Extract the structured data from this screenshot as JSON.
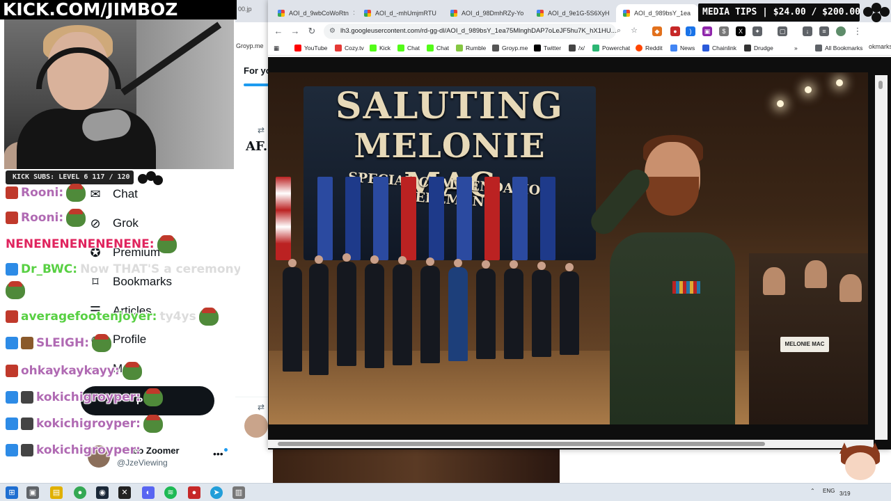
{
  "stream": {
    "banner": "KICK.COM/JIMBOZ",
    "subs_label": "KICK SUBS: LEVEL 6 117 / 120"
  },
  "media_tips": "MEDIA TIPS | $24.00 / $200.00",
  "x_nav": {
    "items": [
      {
        "label": "Chat",
        "icon": "chat-icon",
        "glyph": "✉"
      },
      {
        "label": "Grok",
        "icon": "grok-icon",
        "glyph": "⊘"
      },
      {
        "label": "Premium",
        "icon": "premium-icon",
        "glyph": "✪"
      },
      {
        "label": "Bookmarks",
        "icon": "bookmark-icon",
        "glyph": "⌑"
      },
      {
        "label": "Articles",
        "icon": "articles-icon",
        "glyph": "☰"
      },
      {
        "label": "Profile",
        "icon": "profile-icon",
        "glyph": "☺"
      },
      {
        "label": "M",
        "icon": "more-icon",
        "glyph": "⋯"
      }
    ],
    "post_label": "P",
    "account": {
      "name": "Jimbo Zoomer",
      "handle": "@JzeViewing",
      "more": "•••"
    }
  },
  "chat": {
    "messages": [
      {
        "user": "Rooni:",
        "text": "",
        "color": "#b06ab3"
      },
      {
        "user": "Rooni:",
        "text": "",
        "color": "#b06ab3"
      },
      {
        "user": "NENENENENENENENE:",
        "text": "",
        "color": "#e0245e"
      },
      {
        "user": "Dr_BWC:",
        "text": "Now THAT'S a ceremony",
        "color": "#58d043"
      },
      {
        "user": "averagefootenjoyer:",
        "text": "ty4ys",
        "color": "#58d043"
      },
      {
        "user": "SLEIGH:",
        "text": "",
        "color": "#b06ab3"
      },
      {
        "user": "ohkaykaykayy:",
        "text": "",
        "color": "#b06ab3"
      },
      {
        "user": "kokichigroyper:",
        "text": "",
        "color": "#b06ab3"
      },
      {
        "user": "kokichigroyper:",
        "text": "",
        "color": "#b06ab3"
      },
      {
        "user": "kokichigroyper:",
        "text": "",
        "color": "#b06ab3"
      }
    ]
  },
  "background_page": {
    "for_you": "For yo",
    "af_text": "AF.",
    "groyp": "Groyp.me",
    "tab_fragment": "00.jp",
    "bookmarks_fragment": "okmarks"
  },
  "browser": {
    "tabs": [
      {
        "title": "AOI_d_9wbCoWoRtn"
      },
      {
        "title": "AOI_d_-mhUmjmRTU"
      },
      {
        "title": "AOI_d_98DmhRZy-Yo"
      },
      {
        "title": "AOI_d_9e1G-5S6XyH"
      },
      {
        "title": "AOI_d_989bsY_1ea"
      }
    ],
    "url": "lh3.googleusercontent.com/rd-gg-dl/AOI_d_989bsY_1ea75MlnghDAP7oLeJF5hu7K_hX1HU...",
    "bookmarks": [
      {
        "label": "YouTube",
        "color": "#ff0000"
      },
      {
        "label": "Cozy.tv",
        "color": "#e53935"
      },
      {
        "label": "Kick",
        "color": "#53fc18"
      },
      {
        "label": "Chat",
        "color": "#53fc18"
      },
      {
        "label": "Chat",
        "color": "#53fc18"
      },
      {
        "label": "Rumble",
        "color": "#85c742"
      },
      {
        "label": "Groyp.me",
        "color": "#555555"
      },
      {
        "label": "Twitter",
        "color": "#000000"
      },
      {
        "label": "/x/",
        "color": "#444444"
      },
      {
        "label": "Powerchat",
        "color": "#2bb673"
      },
      {
        "label": "Reddit",
        "color": "#ff4500"
      },
      {
        "label": "News",
        "color": "#4285f4"
      },
      {
        "label": "Chainlink",
        "color": "#2a5ada"
      },
      {
        "label": "Drudge",
        "color": "#333333"
      }
    ],
    "all_bookmarks": "All Bookmarks",
    "more_chevron": "»"
  },
  "image": {
    "title_line1": "SALUTING",
    "title_line2": "MELONIE MAC",
    "subtitle": "SPECIAL COMMENDATION CEREMONY",
    "seat_sign": "MELONIE MAC"
  },
  "taskbar": {
    "lang": "ENG",
    "date": "3/19"
  }
}
